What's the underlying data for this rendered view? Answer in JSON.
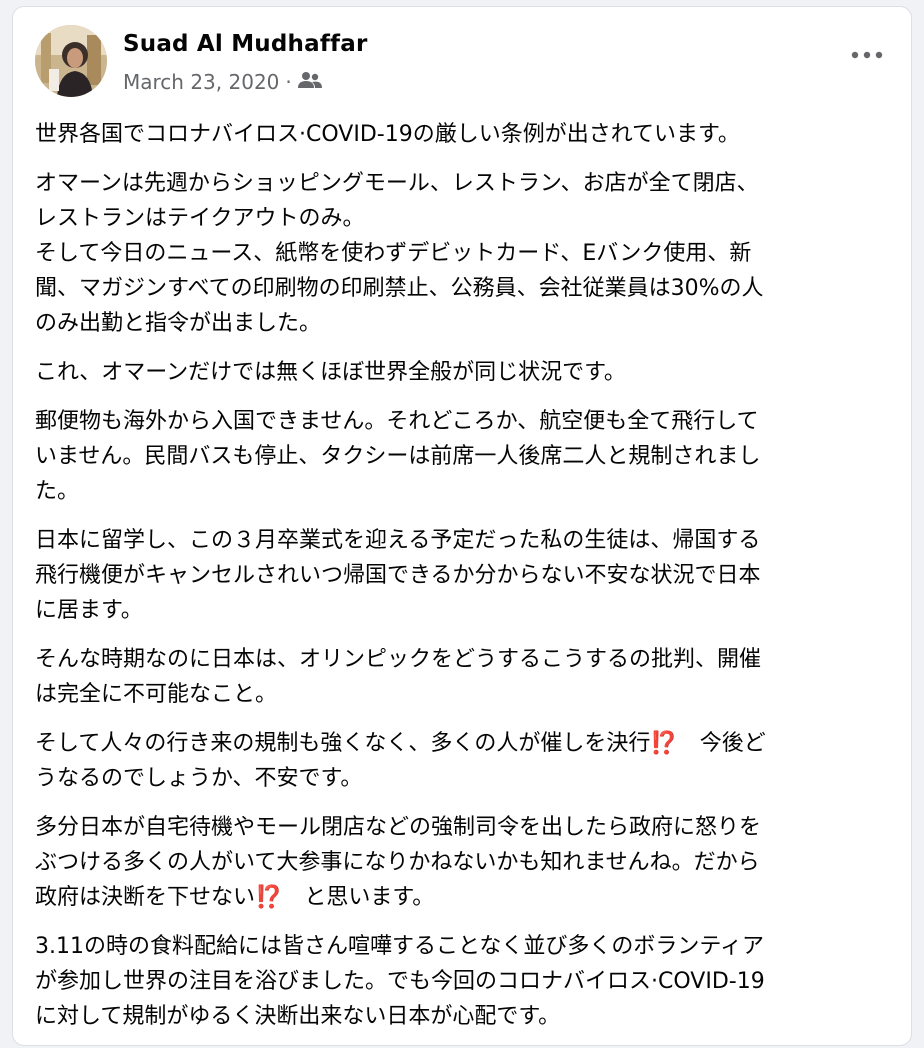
{
  "post": {
    "author": "Suad Al Mudhaffar",
    "date": "March 23, 2020",
    "separator": "·",
    "privacy_icon": "friends-icon",
    "menu_icon": "more-options-icon",
    "paragraphs": [
      [
        "世界各国でコロナバイロス·COVID-19の厳しい条例が出されています。"
      ],
      [
        "オマーンは先週からショッピングモール、レストラン、お店が全て閉店、",
        "レストランはテイクアウトのみ。",
        "そして今日のニュース、紙幣を使わずデビットカード、Eバンク使用、新",
        "聞、マガジンすべての印刷物の印刷禁止、公務員、会社従業員は30%の人",
        "のみ出勤と指令が出ました。"
      ],
      [
        "これ、オマーンだけでは無くほぼ世界全般が同じ状況です。"
      ],
      [
        "郵便物も海外から入国できません。それどころか、航空便も全て飛行して",
        "いません。民間バスも停止、タクシーは前席一人後席二人と規制されまし",
        "た。"
      ],
      [
        "日本に留学し、この３月卒業式を迎える予定だった私の生徒は、帰国する",
        "飛行機便がキャンセルされいつ帰国できるか分からない不安な状況で日本",
        "に居ます。"
      ],
      [
        "そんな時期なのに日本は、オリンピックをどうするこうするの批判、開催",
        "は完全に不可能なこと。"
      ],
      [
        "そして人々の行き来の規制も強くなく、多くの人が催しを決行⁉️　今後ど",
        "うなるのでしょうか、不安です。"
      ],
      [
        "多分日本が自宅待機やモール閉店などの強制司令を出したら政府に怒りを",
        "ぶつける多くの人がいて大参事になりかねないかも知れませんね。だから",
        "政府は決断を下せない⁉️　と思います。"
      ],
      [
        "3.11の時の食料配給には皆さん喧嘩することなく並び多くのボランティア",
        "が参加し世界の注目を浴びました。でも今回のコロナバイロス·COVID-19",
        "に対して規制がゆるく決断出来ない日本が心配です。"
      ]
    ]
  }
}
